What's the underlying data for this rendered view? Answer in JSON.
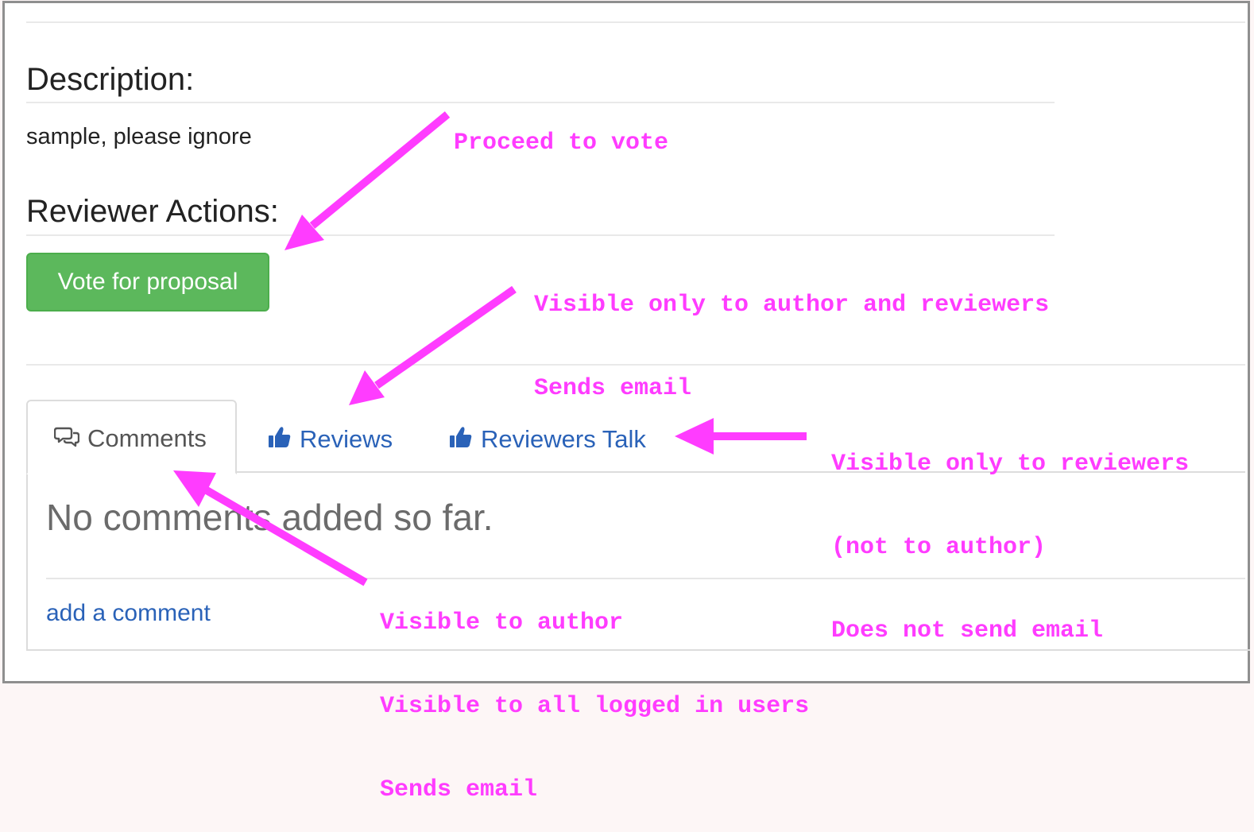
{
  "sections": {
    "description": {
      "heading": "Description:",
      "text": "sample, please ignore"
    },
    "reviewer_actions": {
      "heading": "Reviewer Actions:",
      "vote_button": "Vote for proposal"
    }
  },
  "tabs": [
    {
      "label": "Comments",
      "icon": "comments-icon",
      "active": true
    },
    {
      "label": "Reviews",
      "icon": "thumbs-up-icon",
      "active": false
    },
    {
      "label": "Reviewers Talk",
      "icon": "thumbs-up-icon",
      "active": false
    }
  ],
  "comments_panel": {
    "empty_message": "No comments added so far.",
    "add_link": "add a comment"
  },
  "annotations": {
    "proceed": [
      "Proceed to vote"
    ],
    "reviews": [
      "Visible only to author and reviewers",
      "Sends email"
    ],
    "reviewers_talk": [
      "Visible only to reviewers",
      "(not to author)",
      "Does not send email"
    ],
    "comments": [
      "Visible to author",
      "Visible to all logged in users",
      "Sends email"
    ]
  },
  "colors": {
    "annotation": "#ff3cff",
    "link": "#2a62b8",
    "button": "#5cb85c"
  }
}
